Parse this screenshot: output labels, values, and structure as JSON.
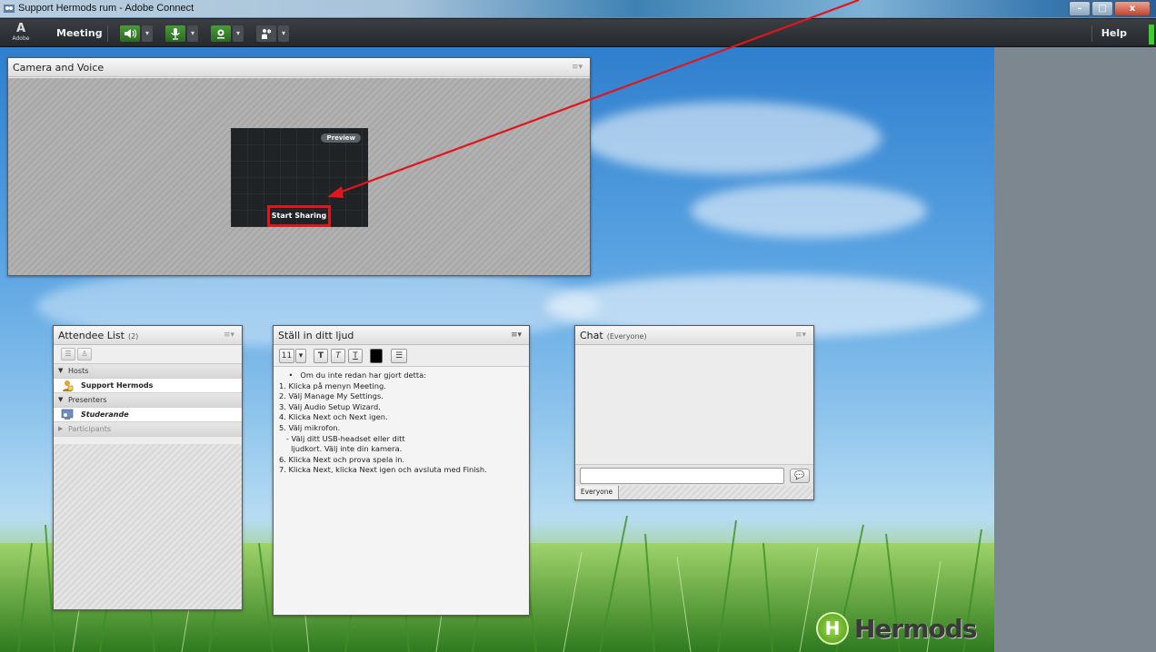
{
  "window": {
    "title": "Support Hermods rum - Adobe Connect",
    "controls": [
      "–",
      "□",
      "x"
    ]
  },
  "menubar": {
    "logo_mark": "A",
    "logo_text": "Adobe",
    "meeting_label": "Meeting",
    "help_label": "Help",
    "tools": [
      "speaker-icon",
      "microphone-icon",
      "webcam-icon",
      "raise-hand-icon"
    ]
  },
  "camera_pod": {
    "title": "Camera and Voice",
    "preview_label": "Preview",
    "start_sharing_label": "Start Sharing"
  },
  "attendee_pod": {
    "title": "Attendee List",
    "count": "(2)",
    "groups": {
      "hosts": "Hosts",
      "presenters": "Presenters",
      "participants": "Participants"
    },
    "hosts": [
      "Support Hermods"
    ],
    "presenters": [
      "Studerande"
    ]
  },
  "notes_pod": {
    "title": "Ställ in ditt ljud",
    "font_size": "11",
    "lines": [
      "    •   Om du inte redan har gjort detta:",
      "1. Klicka på menyn Meeting.",
      "2. Välj Manage My Settings.",
      "3. Välj Audio Setup Wizard.",
      "4. Klicka Next och Next igen.",
      "5. Välj mikrofon.",
      "   - Välj ditt USB-headset eller ditt",
      "     ljudkort. Välj inte din kamera.",
      "6. Klicka Next och prova spela in.",
      "7. Klicka Next, klicka Next igen och avsluta med Finish."
    ]
  },
  "chat_pod": {
    "title": "Chat",
    "audience": "(Everyone)",
    "input_value": "",
    "tab_label": "Everyone"
  },
  "branding": {
    "logo_letter": "H",
    "logo_text": "Hermods"
  },
  "colors": {
    "highlight": "#e0161c",
    "status_green": "#3bd02c"
  }
}
